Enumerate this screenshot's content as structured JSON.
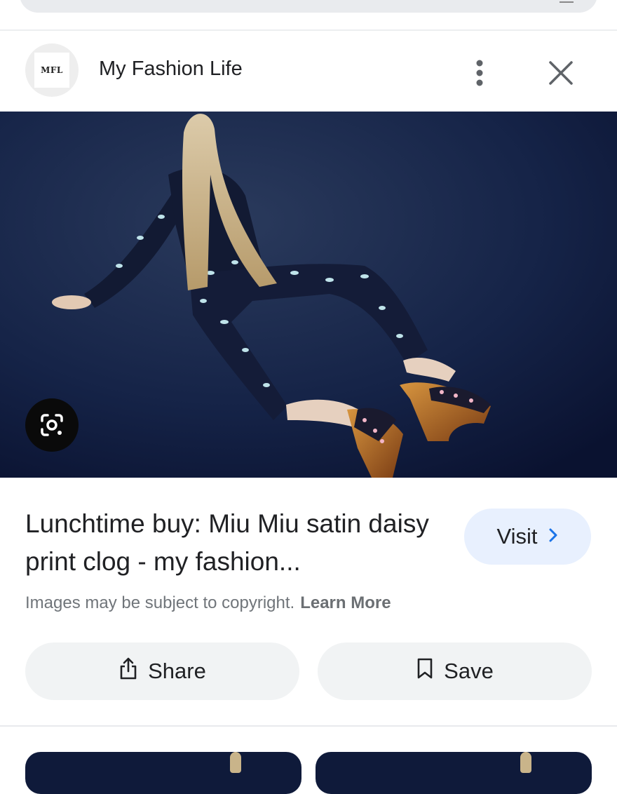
{
  "source": {
    "logo_text": "MFL",
    "name": "My Fashion Life"
  },
  "icons": {
    "more": "more-vert-icon",
    "close": "close-icon",
    "lens": "google-lens-icon",
    "share": "share-icon",
    "save": "bookmark-icon",
    "visit": "chevron-right-icon"
  },
  "result": {
    "title": "Lunchtime buy: Miu Miu satin daisy print clog - my fashion...",
    "visit_label": "Visit",
    "copyright_text": "Images may be subject to copyright.",
    "learn_more": "Learn More"
  },
  "actions": {
    "share_label": "Share",
    "save_label": "Save"
  },
  "colors": {
    "accent_blue": "#1a73e8",
    "visit_bg": "#e8f0fe",
    "pill_bg": "#f1f3f4",
    "photo_bg": "#0d1838"
  }
}
